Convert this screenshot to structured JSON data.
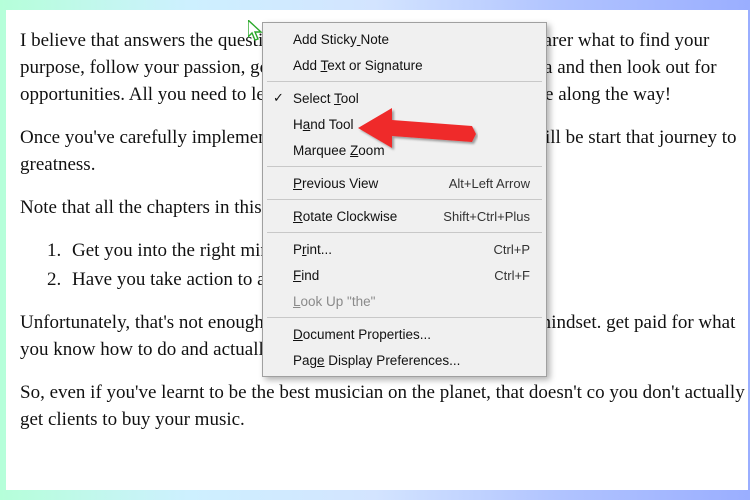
{
  "document": {
    "p1": "I believe that answers the question of, 'What is Purpose?' It's now clearer what to find your purpose, follow your passion, go on that mission, make decisions data and then look out for opportunities. All you need to learn continuous others and help people along the way!",
    "p2": "Once you've carefully implemented everything in this chapter, you will be start that journey to greatness.",
    "p3": "Note that all the chapters in this book do a couple of things:",
    "li1": "Get you into the right mindset",
    "li2": "Have you take action to actually get paid for what you do",
    "p4": "Unfortunately, that's not enough. But I'm not downplaying the right mindset. get paid for what you know how to do and actually do.",
    "p5": "So, even if you've learnt to be the best musician on the planet, that doesn't co you don't actually get clients to buy your music."
  },
  "menu": {
    "items": [
      {
        "label": "Add Sticky Note",
        "u": 10,
        "shortcut": "",
        "disabled": false,
        "checked": false,
        "sep_after": false
      },
      {
        "label": "Add Text or Signature",
        "u": 4,
        "shortcut": "",
        "disabled": false,
        "checked": false,
        "sep_after": true
      },
      {
        "label": "Select Tool",
        "u": 7,
        "shortcut": "",
        "disabled": false,
        "checked": true,
        "sep_after": false
      },
      {
        "label": "Hand Tool",
        "u": 1,
        "shortcut": "",
        "disabled": false,
        "checked": false,
        "sep_after": false
      },
      {
        "label": "Marquee Zoom",
        "u": 8,
        "shortcut": "",
        "disabled": false,
        "checked": false,
        "sep_after": true
      },
      {
        "label": "Previous View",
        "u": 0,
        "shortcut": "Alt+Left Arrow",
        "disabled": false,
        "checked": false,
        "sep_after": true
      },
      {
        "label": "Rotate Clockwise",
        "u": 0,
        "shortcut": "Shift+Ctrl+Plus",
        "disabled": false,
        "checked": false,
        "sep_after": true
      },
      {
        "label": "Print...",
        "u": 1,
        "shortcut": "Ctrl+P",
        "disabled": false,
        "checked": false,
        "sep_after": false
      },
      {
        "label": "Find",
        "u": 0,
        "shortcut": "Ctrl+F",
        "disabled": false,
        "checked": false,
        "sep_after": false
      },
      {
        "label": "Look Up \"the\"",
        "u": 0,
        "shortcut": "",
        "disabled": true,
        "checked": false,
        "sep_after": true
      },
      {
        "label": "Document Properties...",
        "u": 0,
        "shortcut": "",
        "disabled": false,
        "checked": false,
        "sep_after": false
      },
      {
        "label": "Page Display Preferences...",
        "u": 3,
        "shortcut": "",
        "disabled": false,
        "checked": false,
        "sep_after": false
      }
    ]
  }
}
